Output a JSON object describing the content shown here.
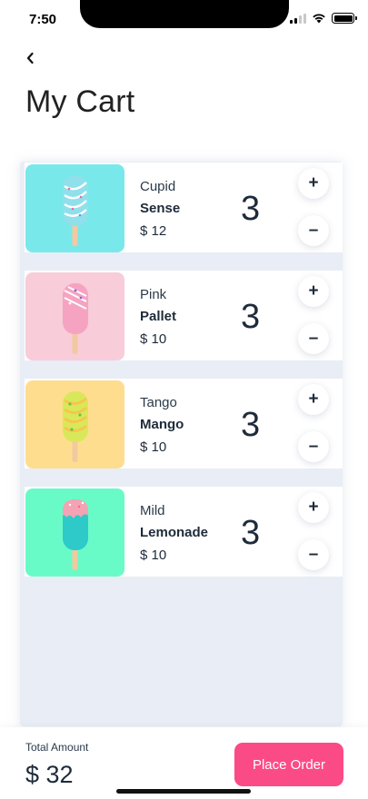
{
  "status_bar": {
    "time": "7:50"
  },
  "page": {
    "title": "My Cart"
  },
  "cart": {
    "items": [
      {
        "name_line1": "Cupid",
        "name_line2": "Sense",
        "price": "$ 12",
        "quantity": "3",
        "image_bg": "#79e8ea",
        "icon": "popsicle-icon"
      },
      {
        "name_line1": "Pink",
        "name_line2": "Pallet",
        "price": "$ 10",
        "quantity": "3",
        "image_bg": "#f8ccd9",
        "icon": "popsicle-icon"
      },
      {
        "name_line1": "Tango",
        "name_line2": "Mango",
        "price": "$ 10",
        "quantity": "3",
        "image_bg": "#ffdd8f",
        "icon": "popsicle-icon"
      },
      {
        "name_line1": "Mild",
        "name_line2": "Lemonade",
        "price": "$ 10",
        "quantity": "3",
        "image_bg": "#69fbc7",
        "icon": "popsicle-icon"
      }
    ],
    "plus_label": "+",
    "minus_label": "–"
  },
  "footer": {
    "total_label": "Total Amount",
    "total_value": "$ 32",
    "place_order_label": "Place Order"
  },
  "colors": {
    "accent": "#fb4b86",
    "panel_bg": "#e8edf6",
    "text_dark": "#1e2b3a"
  }
}
